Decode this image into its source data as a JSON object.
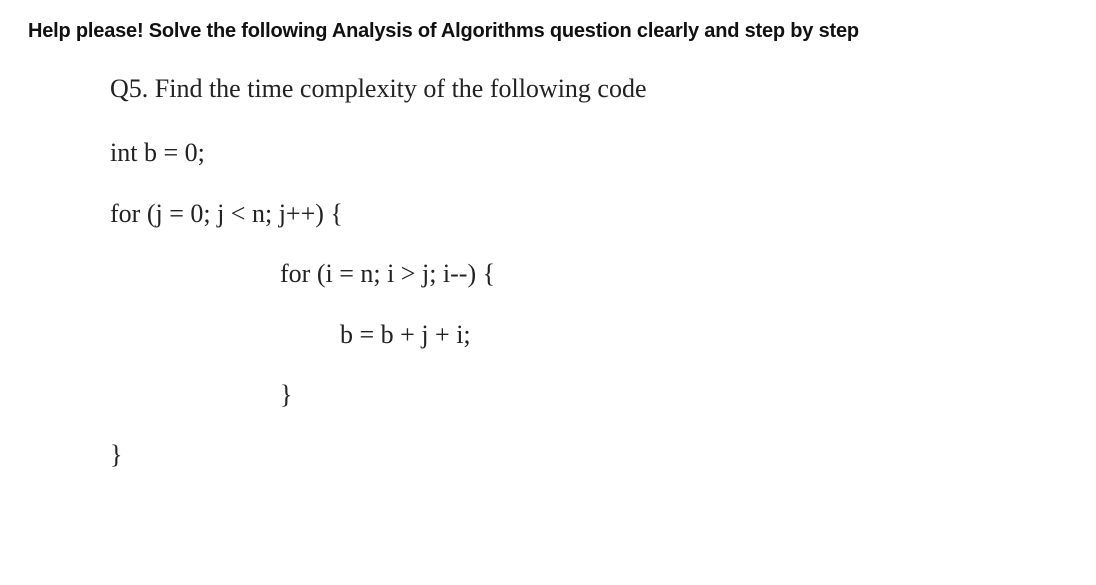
{
  "header": "Help please! Solve the following Analysis of Algorithms question clearly and step by step",
  "question": "Q5. Find the time complexity of the following code",
  "code": {
    "line1": "int b = 0;",
    "line2": "for (j = 0; j < n; j++) {",
    "line3": "for (i = n; i > j; i--) {",
    "line4": "b = b + j + i;",
    "line5": "}",
    "line6": "}"
  }
}
